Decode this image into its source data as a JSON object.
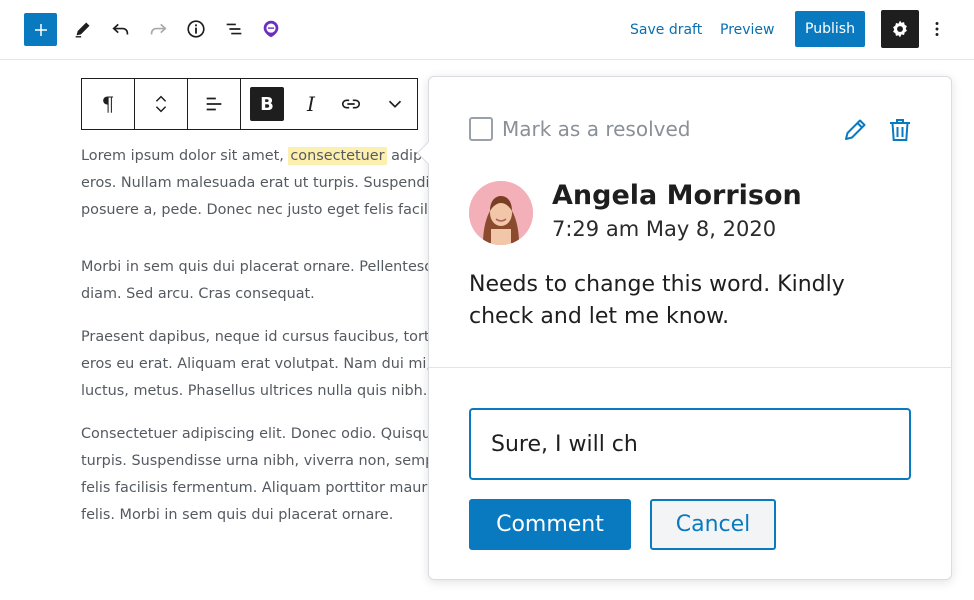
{
  "toolbar": {
    "save_draft_label": "Save draft",
    "preview_label": "Preview",
    "publish_label": "Publish",
    "icons": [
      "plus-icon",
      "pencil-icon",
      "undo-icon",
      "redo-icon",
      "info-icon",
      "list-view-icon",
      "comment-icon",
      "gear-icon",
      "more-vertical-icon"
    ]
  },
  "block_toolbar": {
    "paragraph_symbol": "¶",
    "bold_label": "B",
    "italic_label": "I"
  },
  "editor": {
    "p1": {
      "before": "Lorem ipsum dolor sit amet, ",
      "highlight": "consectetuer",
      "after": " adipiscing elit.",
      "line2": "eros. Nullam malesuada erat ut turpis. Suspendisse",
      "line3": "posuere a, pede. Donec nec justo eget felis facilisis"
    },
    "p2": {
      "line1": "Morbi in sem quis dui placerat ornare. Pellentesque",
      "line2": "diam. Sed arcu. Cras consequat."
    },
    "p3": {
      "line1": "Praesent dapibus, neque id cursus faucibus, tortor",
      "line2": "eros eu erat. Aliquam erat volutpat. Nam dui mi,",
      "line3": "luctus, metus. Phasellus ultrices nulla quis nibh."
    },
    "p4": {
      "line1": "Consectetuer adipiscing elit. Donec odio. Quisque",
      "line2": "turpis. Suspendisse urna nibh, viverra non, semper",
      "line3": "felis facilisis fermentum. Aliquam porttitor mauris",
      "line4": "felis. Morbi in sem quis dui placerat ornare."
    }
  },
  "comment": {
    "resolve_label": "Mark as a resolved",
    "author": "Angela Morrison",
    "timestamp": "7:29 am May 8, 2020",
    "text": "Needs to change this word. Kindly check and let me know.",
    "reply_value": "Sure, I will ch",
    "comment_button_label": "Comment",
    "cancel_button_label": "Cancel"
  },
  "colors": {
    "accent": "#0a7ac0",
    "highlight": "#fdefae",
    "dark": "#1e1e1e"
  }
}
